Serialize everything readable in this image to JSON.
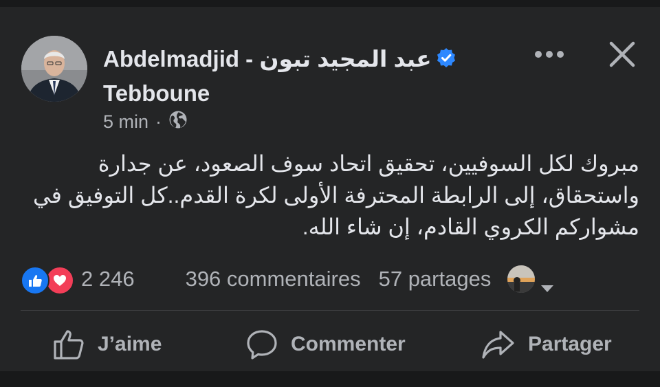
{
  "post": {
    "author_latin": "Abdelmadjid - ",
    "author_arabic": "عبد المجيد  تبون",
    "author_line2": "Tebboune",
    "time": "5 min",
    "dot": "·",
    "text": "مبروك لكل السوفيين، تحقيق اتحاد سوف الصعود، عن جدارة واستحقاق، إلى الرابطة المحترفة الأولى لكرة القدم..كل التوفيق في مشواركم الكروي القادم، إن شاء الله."
  },
  "stats": {
    "reactions_count": "2 246",
    "comments": "396 commentaires",
    "shares": "57 partages"
  },
  "actions": {
    "like": "J’aime",
    "comment": "Commenter",
    "share": "Partager"
  },
  "icons": {
    "verified": "verified-badge-icon",
    "globe": "globe-icon",
    "more": "more-options-icon",
    "close": "close-icon",
    "like_reaction": "like-reaction-icon",
    "love_reaction": "love-reaction-icon",
    "caret": "caret-down-icon"
  },
  "colors": {
    "background": "#18191a",
    "card": "#242526",
    "text_primary": "#e4e6eb",
    "text_secondary": "#b0b3b8",
    "verified_blue": "#2d88ff",
    "like_blue": "#1877f2",
    "love_red": "#f33e58"
  }
}
